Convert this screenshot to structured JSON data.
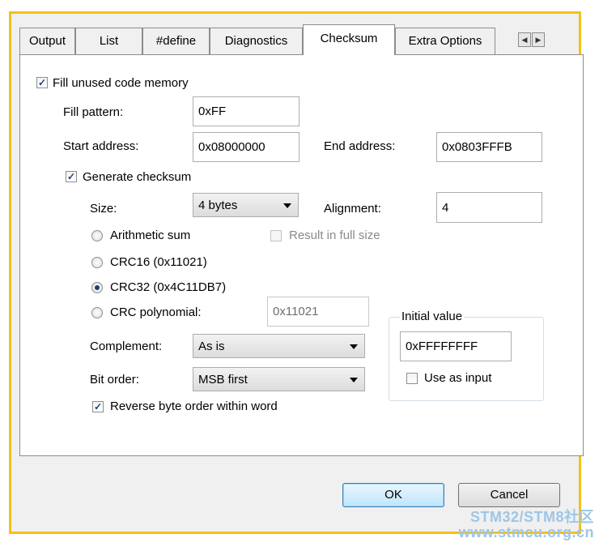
{
  "tabs": {
    "output": "Output",
    "list": "List",
    "define": "#define",
    "diagnostics": "Diagnostics",
    "checksum": "Checksum",
    "extra": "Extra Options"
  },
  "fill": {
    "checkbox_label": "Fill unused code memory",
    "checked": true,
    "pattern_label": "Fill pattern:",
    "pattern_value": "0xFF",
    "start_label": "Start address:",
    "start_value": "0x08000000",
    "end_label": "End address:",
    "end_value": "0x0803FFFB"
  },
  "checksum": {
    "generate_label": "Generate checksum",
    "generate_checked": true,
    "size_label": "Size:",
    "size_value": "4 bytes",
    "alignment_label": "Alignment:",
    "alignment_value": "4",
    "algorithms": [
      {
        "label": "Arithmetic sum",
        "selected": false
      },
      {
        "label": "CRC16 (0x11021)",
        "selected": false
      },
      {
        "label": "CRC32 (0x4C11DB7)",
        "selected": true
      },
      {
        "label": "CRC polynomial:",
        "selected": false
      }
    ],
    "result_full_size_label": "Result in full size",
    "polynomial_value": "0x11021",
    "complement_label": "Complement:",
    "complement_value": "As is",
    "bit_order_label": "Bit order:",
    "bit_order_value": "MSB first",
    "reverse_label": "Reverse byte order within word",
    "reverse_checked": true,
    "initial": {
      "group_label": "Initial value",
      "value": "0xFFFFFFFF",
      "use_as_input_label": "Use as input",
      "use_as_input_checked": false
    }
  },
  "buttons": {
    "ok": "OK",
    "cancel": "Cancel"
  },
  "watermark": {
    "line1": "STM32/STM8社区",
    "line2": "www.stmcu.org.cn"
  },
  "colors": {
    "frame": "#f5c116",
    "watermark": "#9ec6e6",
    "check_mark": "#1f3e7a"
  }
}
